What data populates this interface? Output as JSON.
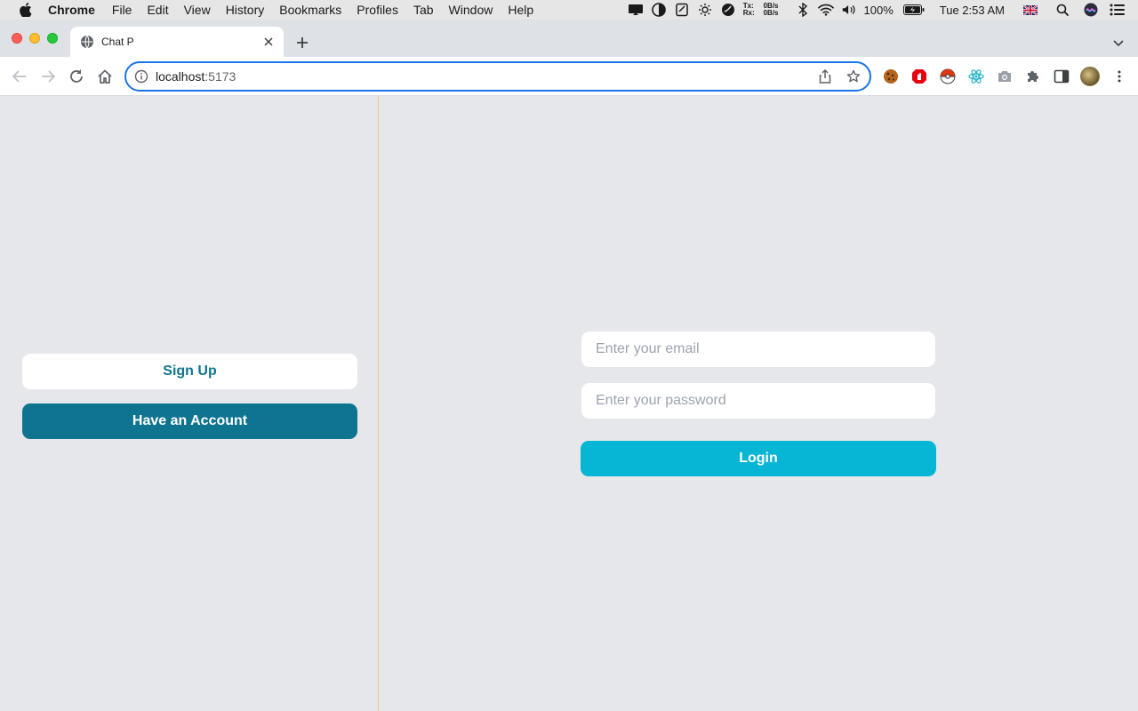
{
  "menubar": {
    "app_name": "Chrome",
    "items": [
      "File",
      "Edit",
      "View",
      "History",
      "Bookmarks",
      "Profiles",
      "Tab",
      "Window",
      "Help"
    ],
    "net_tx_label": "Tx:",
    "net_rx_label": "Rx:",
    "net_tx_value": "0B/s",
    "net_rx_value": "0B/s",
    "battery": "100%",
    "clock": "Tue 2:53 AM"
  },
  "browser": {
    "tab_title": "Chat P",
    "url_host": "localhost",
    "url_port": ":5173"
  },
  "sidebar": {
    "signup_label": "Sign Up",
    "have_account_label": "Have an Account"
  },
  "login_form": {
    "email_placeholder": "Enter your email",
    "password_placeholder": "Enter your password",
    "login_label": "Login"
  },
  "colors": {
    "primary_dark": "#0e7490",
    "primary_light": "#06b6d4",
    "page_bg": "#e5e7eb",
    "divider": "#e8c98a",
    "omnibox_focus": "#1a73e8"
  }
}
